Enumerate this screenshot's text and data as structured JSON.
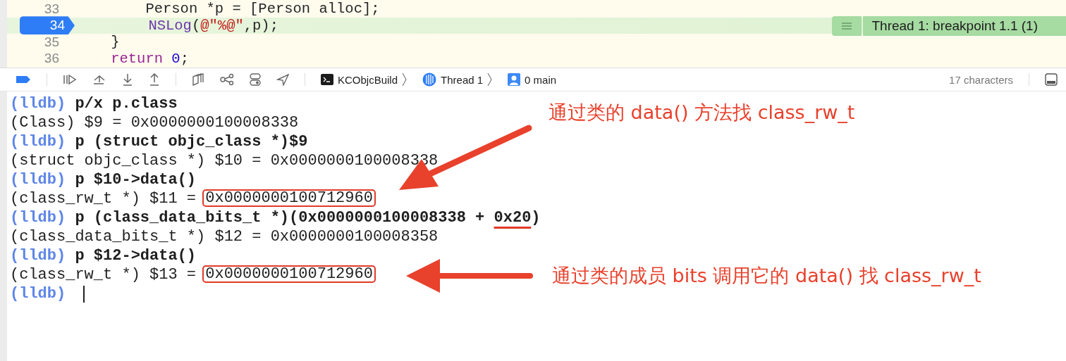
{
  "editor": {
    "lines": [
      {
        "number": "33",
        "current": false,
        "segments": [
          {
            "text": "        Person *p = [Person alloc];",
            "kind": "plain"
          }
        ]
      },
      {
        "number": "34",
        "current": true,
        "segments": [
          {
            "text": "        NSLog",
            "kind": "func"
          },
          {
            "text": "(",
            "kind": "plain"
          },
          {
            "text": "@\"%@\"",
            "kind": "string"
          },
          {
            "text": ",p);",
            "kind": "plain"
          }
        ]
      },
      {
        "number": "35",
        "current": false,
        "segments": [
          {
            "text": "    }",
            "kind": "plain"
          }
        ]
      },
      {
        "number": "36",
        "current": false,
        "segments": [
          {
            "text": "    return",
            "kind": "keyword"
          },
          {
            "text": " 0",
            "kind": "number"
          },
          {
            "text": ";",
            "kind": "plain"
          }
        ]
      }
    ],
    "banner": "Thread 1: breakpoint 1.1 (1)"
  },
  "debug_bar": {
    "breadcrumbs": [
      {
        "text": "KCObjcBuild",
        "kind": "target"
      },
      {
        "text": "Thread 1",
        "kind": "thread"
      },
      {
        "text": "0 main",
        "kind": "frame"
      }
    ],
    "status": "17 characters"
  },
  "console": {
    "lines": [
      {
        "kind": "command",
        "prompt": "(lldb)",
        "segments": [
          {
            "text": "p/x p.class"
          }
        ]
      },
      {
        "kind": "output",
        "segments": [
          {
            "text": "(Class) $9 = 0x0000000100008338"
          }
        ]
      },
      {
        "kind": "command",
        "prompt": "(lldb)",
        "segments": [
          {
            "text": "p (struct objc_class *)$9"
          }
        ]
      },
      {
        "kind": "output",
        "segments": [
          {
            "text": "(struct objc_class *) $10 = 0x0000000100008338"
          }
        ]
      },
      {
        "kind": "command",
        "prompt": "(lldb)",
        "segments": [
          {
            "text": "p $10->data()"
          }
        ]
      },
      {
        "kind": "output",
        "segments": [
          {
            "text": "(class_rw_t *) $11 = "
          },
          {
            "text": "0x0000000100712960",
            "boxed": true
          }
        ]
      },
      {
        "kind": "command",
        "prompt": "(lldb)",
        "segments": [
          {
            "text": "p (class_data_bits_t *)(0x0000000100008338 + "
          },
          {
            "text": "0x20",
            "underlined": true
          },
          {
            "text": ")"
          }
        ]
      },
      {
        "kind": "output",
        "segments": [
          {
            "text": "(class_data_bits_t *) $12 = 0x0000000100008358"
          }
        ]
      },
      {
        "kind": "command",
        "prompt": "(lldb)",
        "segments": [
          {
            "text": "p $12->data()"
          }
        ]
      },
      {
        "kind": "output",
        "segments": [
          {
            "text": "(class_rw_t *) $13 = "
          },
          {
            "text": "0x0000000100712960",
            "boxed": true
          }
        ]
      },
      {
        "prompt": "(lldb)",
        "cursor": true
      }
    ]
  },
  "annotations": [
    {
      "text": "通过类的 data() 方法找 class_rw_t"
    },
    {
      "text": "通过类的成员 bits 调用它的 data() 找 class_rw_t"
    }
  ]
}
